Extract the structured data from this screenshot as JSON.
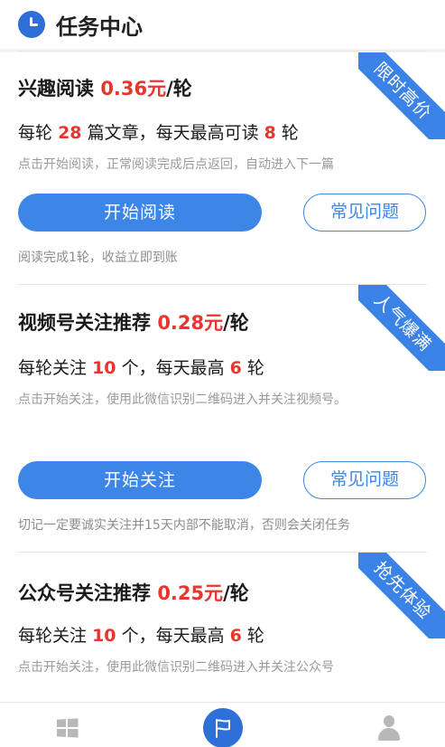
{
  "header": {
    "title": "任务中心"
  },
  "tasks": [
    {
      "ribbon": "限时高价",
      "title": "兴趣阅读",
      "price": "0.36元",
      "unit": "/轮",
      "rule_pre": "每轮",
      "rule_num1": "28",
      "rule_mid": "篇文章，每天最高可读",
      "rule_num2": "8",
      "rule_post": "轮",
      "desc": "点击开始阅读，正常阅读完成后点返回，自动进入下一篇",
      "primary_button": "开始阅读",
      "faq_button": "常见问题",
      "note": "阅读完成1轮，收益立即到账"
    },
    {
      "ribbon": "人气爆满",
      "title": "视频号关注推荐",
      "price": "0.28元",
      "unit": "/轮",
      "rule_pre": "每轮关注",
      "rule_num1": "10",
      "rule_mid": "个，每天最高",
      "rule_num2": "6",
      "rule_post": "轮",
      "desc": "点击开始关注，使用此微信识别二维码进入并关注视频号。",
      "primary_button": "开始关注",
      "faq_button": "常见问题",
      "note": "切记一定要诚实关注并15天内部不能取消，否则会关闭任务"
    },
    {
      "ribbon": "抢先体验",
      "title": "公众号关注推荐",
      "price": "0.25元",
      "unit": "/轮",
      "rule_pre": "每轮关注",
      "rule_num1": "10",
      "rule_mid": "个，每天最高",
      "rule_num2": "6",
      "rule_post": "轮",
      "desc": "点击开始关注，使用此微信识别二维码进入并关注公众号"
    }
  ],
  "tabbar": {
    "items": [
      {
        "icon": "windows-icon"
      },
      {
        "icon": "flag-icon",
        "active": true
      },
      {
        "icon": "user-icon"
      }
    ]
  },
  "colors": {
    "accent": "#3d86e8",
    "price": "#e8362e",
    "brand": "#2f6fd8"
  }
}
